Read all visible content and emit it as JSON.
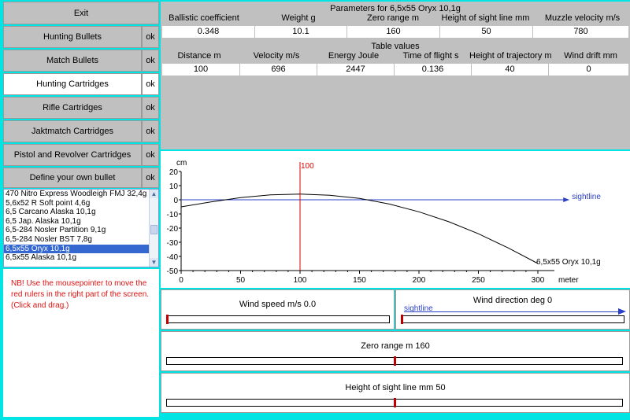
{
  "nav": {
    "exit": "Exit",
    "items": [
      {
        "label": "Hunting Bullets",
        "ok": "ok"
      },
      {
        "label": "Match Bullets",
        "ok": "ok"
      },
      {
        "label": "Hunting Cartridges",
        "ok": "ok"
      },
      {
        "label": "Rifle Cartridges",
        "ok": "ok"
      },
      {
        "label": "Jaktmatch Cartridges",
        "ok": "ok"
      },
      {
        "label": "Pistol and Revolver Cartridges",
        "ok": "ok"
      },
      {
        "label": "Define your own bullet",
        "ok": "ok"
      }
    ]
  },
  "list": {
    "items": [
      "470 Nitro Express Woodleigh FMJ 32,4g",
      "5,6x52 R Soft point 4,6g",
      "6,5 Carcano Alaska 10,1g",
      "6,5 Jap. Alaska 10,1g",
      "6,5-284 Nosler Partition 9,1g",
      "6,5-284 Nosler BST 7,8g",
      "6,5x55 Oryx 10,1g",
      "6,5x55 Alaska 10,1g"
    ],
    "selected": "6,5x55 Oryx 10,1g"
  },
  "note": "NB! Use the mousepointer to move the red rulers in the right part of the screen. (Click and drag.)",
  "params": {
    "title": "Parameters for 6,5x55 Oryx 10,1g",
    "headers": [
      "Ballistic coefficient",
      "Weight g",
      "Zero range m",
      "Height of sight line mm",
      "Muzzle velocity m/s"
    ],
    "values": [
      "0.348",
      "10.1",
      "160",
      "50",
      "780"
    ]
  },
  "table": {
    "title": "Table values",
    "headers": [
      "Distance m",
      "Velocity m/s",
      "Energy Joule",
      "Time of flight s",
      "Height of trajectory mm",
      "Wind drift mm"
    ],
    "values": [
      "100",
      "696",
      "2447",
      "0.136",
      "40",
      "0"
    ]
  },
  "chart": {
    "ylabel": "cm",
    "xlabel": "meter",
    "ruler_label": "100",
    "sightline_label": "sightline",
    "series_label": "6,5x55 Oryx 10,1g",
    "yticks": [
      "20",
      "10",
      "0",
      "-10",
      "-20",
      "-30",
      "-40",
      "-50"
    ],
    "xticks": [
      "0",
      "50",
      "100",
      "150",
      "200",
      "250",
      "300"
    ]
  },
  "chart_data": {
    "type": "line",
    "xlabel": "meter",
    "ylabel": "cm",
    "xlim": [
      0,
      300
    ],
    "ylim": [
      -50,
      20
    ],
    "series": [
      {
        "name": "6,5x55 Oryx 10,1g",
        "x": [
          0,
          25,
          50,
          75,
          100,
          125,
          150,
          175,
          200,
          225,
          250,
          275,
          300
        ],
        "y": [
          -5,
          -1.5,
          1.5,
          3.5,
          4,
          3.2,
          1,
          -3,
          -8.5,
          -15.5,
          -24,
          -34,
          -45
        ]
      },
      {
        "name": "sightline",
        "x": [
          0,
          320
        ],
        "y": [
          0,
          0
        ]
      }
    ],
    "ruler_x": 100
  },
  "sliders": {
    "wind_speed": {
      "label": "Wind speed m/s 0.0",
      "value": 0
    },
    "wind_direction": {
      "label": "Wind direction deg 0",
      "sightline": "sightline",
      "value": 0
    },
    "zero_range": {
      "label": "Zero range m 160",
      "value": 0.5
    },
    "sight_height": {
      "label": "Height of sight line mm 50",
      "value": 0.5
    }
  },
  "colors": {
    "accent": "#3467d0",
    "ruler": "#e00000",
    "sightline": "#2a3fc8",
    "background": "#00e4e4"
  }
}
